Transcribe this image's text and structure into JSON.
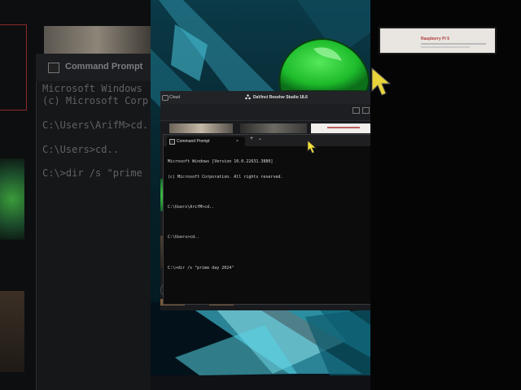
{
  "left_panel": {
    "title": "Command Prompt",
    "lines": [
      "Microsoft Windows",
      "(c) Microsoft Corp",
      "",
      "C:\\Users\\ArifM>cd.",
      "",
      "C:\\Users>cd..",
      "",
      "C:\\>dir /s \"prime"
    ]
  },
  "right_panel": {
    "thumb_title": "Raspberry Pi 5"
  },
  "resolve": {
    "left_label": "Cloud",
    "title": "DaVinci Resolve Studio 18.6"
  },
  "terminal": {
    "tab_label": "Command Prompt",
    "tab_close": "×",
    "new_tab": "+",
    "tab_menu": "⌄",
    "lines": [
      "Microsoft Windows [Version 10.0.22631.3880]",
      "(c) Microsoft Corporation. All rights reserved.",
      "",
      "C:\\Users\\ArifM>cd..",
      "",
      "C:\\Users>cd..",
      "",
      "C:\\>dir /s \"prime day 2024\""
    ]
  },
  "colors": {
    "accent_green": "#39c83a",
    "glass_cyan": "#4fd6e8",
    "terminal_bg": "#0c0c0c",
    "cursor_yellow": "#f2e23a"
  }
}
